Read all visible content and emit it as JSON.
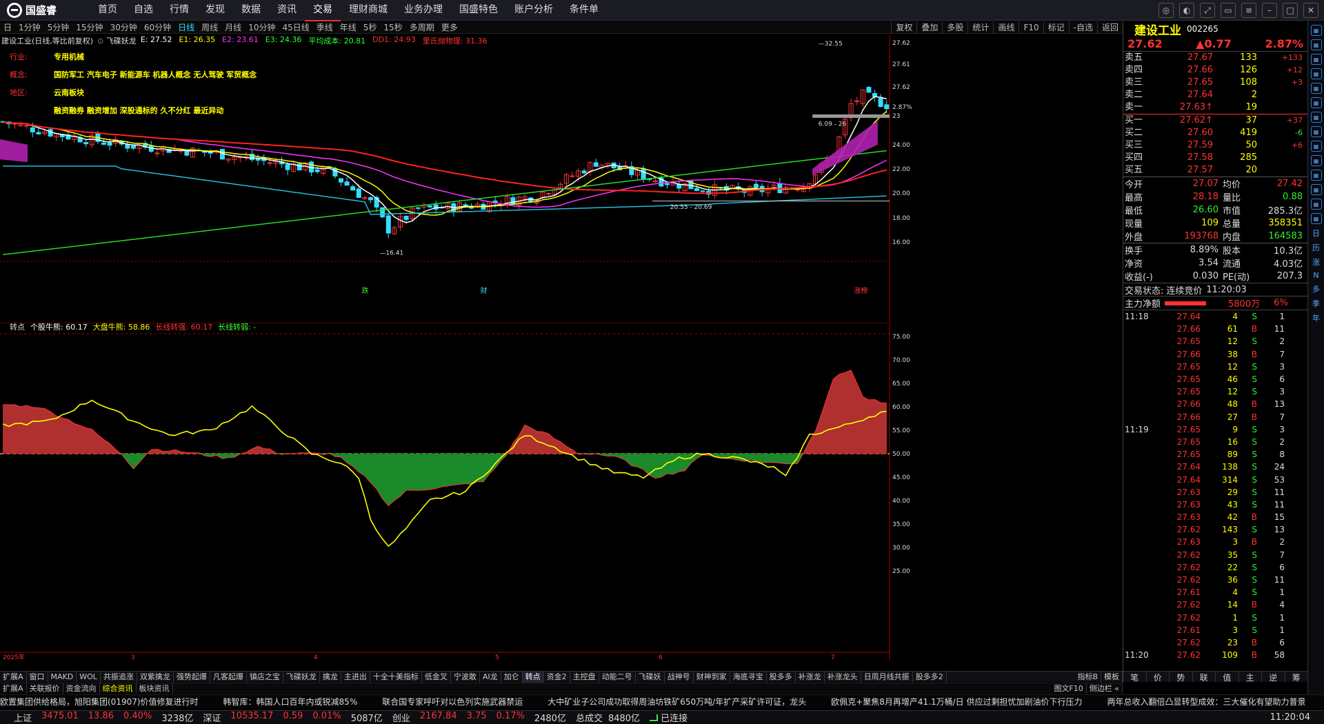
{
  "app": {
    "logo_text": "国盛睿"
  },
  "nav": [
    "首页",
    "自选",
    "行情",
    "发现",
    "数据",
    "资讯",
    "交易",
    "理财商城",
    "业务办理",
    "国盛特色",
    "账户分析",
    "条件单"
  ],
  "nav_active": 6,
  "window_controls": [
    "chat-icon",
    "skin-icon",
    "fullscreen-icon",
    "restore-icon",
    "menu-icon",
    "minimize-icon",
    "maximize-icon",
    "close-icon"
  ],
  "periods": [
    "日",
    "1分钟",
    "5分钟",
    "15分钟",
    "30分钟",
    "60分钟",
    "日线",
    "周线",
    "月线",
    "10分钟",
    "45日线",
    "季线",
    "年线",
    "5秒",
    "15秒",
    "多周期",
    "更多"
  ],
  "period_active": 6,
  "chart_tools": [
    "复权",
    "叠加",
    "多股",
    "统计",
    "画线",
    "F10",
    "标记",
    "-自选",
    "返回"
  ],
  "stock": {
    "name": "建设工业",
    "code": "002265",
    "price": "27.62",
    "change": "▲0.77",
    "pct": "2.87%"
  },
  "indicator_line": {
    "title": "建设工业(日线,等比前复权)",
    "ind_name": "飞碟妖龙",
    "items": [
      {
        "text": "E: 27.52",
        "color": "#ffffff"
      },
      {
        "text": "E1: 26.35",
        "color": "#ffff00"
      },
      {
        "text": "E2: 23.61",
        "color": "#ff33ff"
      },
      {
        "text": "E3: 24.36",
        "color": "#33ff33"
      },
      {
        "text": "平均成本: 20.81",
        "color": "#33ff33"
      },
      {
        "text": "DD1: 24.93",
        "color": "#ff3333"
      },
      {
        "text": "里氏抛物理: 31.36",
        "color": "#ff3333"
      }
    ]
  },
  "info": [
    {
      "k": "行业:",
      "v": "专用机械"
    },
    {
      "k": "概念:",
      "v": "国防军工 汽车电子 新能源车 机器人概念 无人驾驶 军贸概念"
    },
    {
      "k": "地区:",
      "v": "云南板块"
    },
    {
      "k": "",
      "v": "融资融券 融资增加 深股通标的 久不分红 最近异动"
    }
  ],
  "main_yaxis": [
    "27.62",
    "27.61",
    "27.62",
    "2.87%",
    "23",
    "24.00",
    "22.00",
    "20.00",
    "18.00",
    "16.00"
  ],
  "main_annotations": {
    "high": "32.55",
    "low": "16.41",
    "range1": "20.55 - 20.69",
    "range2": "6.09 - 26"
  },
  "event_labels": [
    "跌",
    "财",
    "涨榜"
  ],
  "sub_header": {
    "items": [
      {
        "text": "转点",
        "color": "#dddddd"
      },
      {
        "text": "个股牛熊: 60.17",
        "color": "#ffffff"
      },
      {
        "text": "大盘牛熊: 58.86",
        "color": "#ffff00"
      },
      {
        "text": "长线转强: 60.17",
        "color": "#ff3333"
      },
      {
        "text": "长线转弱: -",
        "color": "#33ff33"
      }
    ]
  },
  "sub_yaxis": [
    "75.00",
    "70.00",
    "65.00",
    "60.00",
    "55.00",
    "50.00",
    "45.00",
    "40.00",
    "35.00",
    "30.00",
    "25.00"
  ],
  "time_axis": [
    "2025年",
    "3",
    "4",
    "5",
    "6",
    "7"
  ],
  "indicator_tabs": [
    "扩展A",
    "窗口",
    "MAKD",
    "WOL",
    "共振追涨",
    "双紫擒龙",
    "强势起爆",
    "凡客起爆",
    "镇店之宝",
    "飞碟妖龙",
    "擒龙",
    "主进出",
    "十全十美指标",
    "低金叉",
    "宁波敢",
    "AI龙",
    "加仑",
    "转点",
    "资金2",
    "主控盘",
    "动能二号",
    "飞碟妖",
    "战神号",
    "财神到家",
    "海底寻宝",
    "股多多",
    "补涨龙",
    "补涨龙头",
    "日周月线共振",
    "股多多2"
  ],
  "indicator_tab_active": 17,
  "indicator_tabs_right": [
    "指标B",
    "模板"
  ],
  "news_tabs": [
    "扩展A",
    "关联报价",
    "资金流向",
    "综合资讯",
    "板块资讯"
  ],
  "news_tab_active": 3,
  "news_right": [
    "图文F10",
    "侧边栏 «"
  ],
  "ticker": [
    "欧置集团供给格局，旭阳集团(01907)价值修复进行时",
    "韩智库：韩国人口百年内或锐减85%",
    "联合国专家呼吁对以色列实施武器禁运",
    "大中矿业子公司成功取得周油坊铁矿650万吨/年扩产采矿许可证，龙头",
    "欧佩克+聚焦8月再增产41.1万桶/日 供应过剩担忧加剧油价下行压力",
    "两年总收入翻倍凸显转型成效：三大催化有望助力普景"
  ],
  "indices": [
    {
      "name": "上证",
      "val": "3475.01",
      "chg": "13.86",
      "pct": "0.40%",
      "amt": "3238亿"
    },
    {
      "name": "深证",
      "val": "10535.17",
      "chg": "0.59",
      "pct": "0.01%",
      "amt": "5087亿"
    },
    {
      "name": "创业",
      "val": "2167.84",
      "chg": "3.75",
      "pct": "0.17%",
      "amt": "2480亿"
    }
  ],
  "status": {
    "total_label": "总成交",
    "total": "8480亿",
    "conn": "已连接",
    "time": "11:20:04"
  },
  "orderbook": {
    "asks": [
      {
        "l": "卖五",
        "p": "27.67",
        "v": "133",
        "c": "+133"
      },
      {
        "l": "卖四",
        "p": "27.66",
        "v": "126",
        "c": "+12"
      },
      {
        "l": "卖三",
        "p": "27.65",
        "v": "108",
        "c": "+3"
      },
      {
        "l": "卖二",
        "p": "27.64",
        "v": "2",
        "c": ""
      },
      {
        "l": "卖一",
        "p": "27.63↑",
        "v": "19",
        "c": ""
      }
    ],
    "bids": [
      {
        "l": "买一",
        "p": "27.62↑",
        "v": "37",
        "c": "+37"
      },
      {
        "l": "买二",
        "p": "27.60",
        "v": "419",
        "c": "-6"
      },
      {
        "l": "买三",
        "p": "27.59",
        "v": "50",
        "c": "+6"
      },
      {
        "l": "买四",
        "p": "27.58",
        "v": "285",
        "c": ""
      },
      {
        "l": "买五",
        "p": "27.57",
        "v": "20",
        "c": ""
      }
    ]
  },
  "stats1": [
    {
      "k": "今开",
      "v": "27.07",
      "vc": "red",
      "k2": "均价",
      "v2": "27.42",
      "v2c": "red"
    },
    {
      "k": "最高",
      "v": "28.18",
      "vc": "red",
      "k2": "量比",
      "v2": "0.88",
      "v2c": "grn"
    },
    {
      "k": "最低",
      "v": "26.60",
      "vc": "grn",
      "k2": "市值",
      "v2": "285.3亿",
      "v2c": "wht"
    },
    {
      "k": "现量",
      "v": "109",
      "vc": "yel",
      "k2": "总量",
      "v2": "358351",
      "v2c": "yel"
    },
    {
      "k": "外盘",
      "v": "193768",
      "vc": "red",
      "k2": "内盘",
      "v2": "164583",
      "v2c": "grn"
    }
  ],
  "stats2": [
    {
      "k": "换手",
      "v": "8.89%",
      "vc": "wht",
      "k2": "股本",
      "v2": "10.3亿",
      "v2c": "wht"
    },
    {
      "k": "净资",
      "v": "3.54",
      "vc": "wht",
      "k2": "流通",
      "v2": "4.03亿",
      "v2c": "wht"
    },
    {
      "k": "收益(-)",
      "v": "0.030",
      "vc": "wht",
      "k2": "PE(动)",
      "v2": "207.3",
      "v2c": "wht"
    }
  ],
  "trade_status": {
    "label": "交易状态:",
    "value": "连续竞价",
    "time": "11:20:03"
  },
  "main_force": {
    "label": "主力净额",
    "value": "5800万",
    "pct": "6%"
  },
  "ticks": [
    {
      "t": "11:18",
      "p": "27.64",
      "v": "4",
      "bs": "S",
      "n": "1"
    },
    {
      "t": "",
      "p": "27.66",
      "v": "61",
      "bs": "B",
      "n": "11"
    },
    {
      "t": "",
      "p": "27.65",
      "v": "12",
      "bs": "S",
      "n": "2"
    },
    {
      "t": "",
      "p": "27.66",
      "v": "38",
      "bs": "B",
      "n": "7"
    },
    {
      "t": "",
      "p": "27.65",
      "v": "12",
      "bs": "S",
      "n": "3"
    },
    {
      "t": "",
      "p": "27.65",
      "v": "46",
      "bs": "S",
      "n": "6"
    },
    {
      "t": "",
      "p": "27.65",
      "v": "12",
      "bs": "S",
      "n": "3"
    },
    {
      "t": "",
      "p": "27.66",
      "v": "48",
      "bs": "B",
      "n": "13"
    },
    {
      "t": "",
      "p": "27.66",
      "v": "27",
      "bs": "B",
      "n": "7"
    },
    {
      "t": "11:19",
      "p": "27.65",
      "v": "9",
      "bs": "S",
      "n": "3"
    },
    {
      "t": "",
      "p": "27.65",
      "v": "16",
      "bs": "S",
      "n": "2"
    },
    {
      "t": "",
      "p": "27.65",
      "v": "89",
      "bs": "S",
      "n": "8"
    },
    {
      "t": "",
      "p": "27.64",
      "v": "138",
      "bs": "S",
      "n": "24"
    },
    {
      "t": "",
      "p": "27.64",
      "v": "314",
      "bs": "S",
      "n": "53"
    },
    {
      "t": "",
      "p": "27.63",
      "v": "29",
      "bs": "S",
      "n": "11"
    },
    {
      "t": "",
      "p": "27.63",
      "v": "43",
      "bs": "S",
      "n": "11"
    },
    {
      "t": "",
      "p": "27.63",
      "v": "42",
      "bs": "B",
      "n": "15"
    },
    {
      "t": "",
      "p": "27.62",
      "v": "143",
      "bs": "S",
      "n": "13"
    },
    {
      "t": "",
      "p": "27.63",
      "v": "3",
      "bs": "B",
      "n": "2"
    },
    {
      "t": "",
      "p": "27.62",
      "v": "35",
      "bs": "S",
      "n": "7"
    },
    {
      "t": "",
      "p": "27.62",
      "v": "22",
      "bs": "S",
      "n": "6"
    },
    {
      "t": "",
      "p": "27.62",
      "v": "36",
      "bs": "S",
      "n": "11"
    },
    {
      "t": "",
      "p": "27.61",
      "v": "4",
      "bs": "S",
      "n": "1"
    },
    {
      "t": "",
      "p": "27.62",
      "v": "14",
      "bs": "B",
      "n": "4"
    },
    {
      "t": "",
      "p": "27.62",
      "v": "1",
      "bs": "S",
      "n": "1"
    },
    {
      "t": "",
      "p": "27.61",
      "v": "3",
      "bs": "S",
      "n": "1"
    },
    {
      "t": "",
      "p": "27.62",
      "v": "23",
      "bs": "B",
      "n": "6"
    },
    {
      "t": "11:20",
      "p": "27.62",
      "v": "109",
      "bs": "B",
      "n": "58"
    }
  ],
  "right_bottom_tabs": [
    "笔",
    "价",
    "势",
    "联",
    "值",
    "主",
    "逆",
    "筹"
  ],
  "side_chars": [
    "日",
    "历",
    "涨",
    "N",
    "多",
    "季",
    "年"
  ],
  "chart_data": {
    "type": "candlestick",
    "price_range": [
      16.0,
      32.55
    ],
    "oscillator_range": [
      25,
      75
    ],
    "oscillator_baseline": 50,
    "last_close": 27.62,
    "recent_high": 32.55,
    "recent_low": 16.41,
    "oscillator_latest": {
      "stock": 60.17,
      "market": 58.86
    }
  }
}
